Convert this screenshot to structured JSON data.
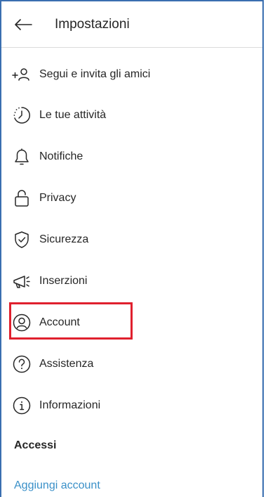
{
  "header": {
    "title": "Impostazioni",
    "back_icon": "arrow-left-icon"
  },
  "menu": {
    "items": [
      {
        "label": "Segui e invita gli amici",
        "icon": "add-person-icon"
      },
      {
        "label": "Le tue attività",
        "icon": "activity-clock-icon"
      },
      {
        "label": "Notifiche",
        "icon": "bell-icon"
      },
      {
        "label": "Privacy",
        "icon": "lock-icon"
      },
      {
        "label": "Sicurezza",
        "icon": "shield-check-icon"
      },
      {
        "label": "Inserzioni",
        "icon": "megaphone-icon"
      },
      {
        "label": "Account",
        "icon": "account-circle-icon"
      },
      {
        "label": "Assistenza",
        "icon": "help-circle-icon"
      },
      {
        "label": "Informazioni",
        "icon": "info-circle-icon"
      }
    ]
  },
  "accessi": {
    "title": "Accessi",
    "add_account": "Aggiungi account"
  },
  "colors": {
    "highlight": "#e0202e",
    "link": "#3a90c8",
    "frame": "#3a6fb0"
  }
}
